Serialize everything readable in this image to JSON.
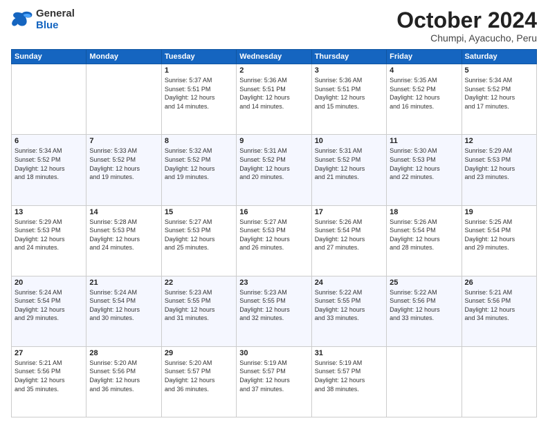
{
  "logo": {
    "line1": "General",
    "line2": "Blue"
  },
  "title": "October 2024",
  "subtitle": "Chumpi, Ayacucho, Peru",
  "days": [
    "Sunday",
    "Monday",
    "Tuesday",
    "Wednesday",
    "Thursday",
    "Friday",
    "Saturday"
  ],
  "weeks": [
    [
      {
        "date": "",
        "info": ""
      },
      {
        "date": "",
        "info": ""
      },
      {
        "date": "1",
        "info": "Sunrise: 5:37 AM\nSunset: 5:51 PM\nDaylight: 12 hours\nand 14 minutes."
      },
      {
        "date": "2",
        "info": "Sunrise: 5:36 AM\nSunset: 5:51 PM\nDaylight: 12 hours\nand 14 minutes."
      },
      {
        "date": "3",
        "info": "Sunrise: 5:36 AM\nSunset: 5:51 PM\nDaylight: 12 hours\nand 15 minutes."
      },
      {
        "date": "4",
        "info": "Sunrise: 5:35 AM\nSunset: 5:52 PM\nDaylight: 12 hours\nand 16 minutes."
      },
      {
        "date": "5",
        "info": "Sunrise: 5:34 AM\nSunset: 5:52 PM\nDaylight: 12 hours\nand 17 minutes."
      }
    ],
    [
      {
        "date": "6",
        "info": "Sunrise: 5:34 AM\nSunset: 5:52 PM\nDaylight: 12 hours\nand 18 minutes."
      },
      {
        "date": "7",
        "info": "Sunrise: 5:33 AM\nSunset: 5:52 PM\nDaylight: 12 hours\nand 19 minutes."
      },
      {
        "date": "8",
        "info": "Sunrise: 5:32 AM\nSunset: 5:52 PM\nDaylight: 12 hours\nand 19 minutes."
      },
      {
        "date": "9",
        "info": "Sunrise: 5:31 AM\nSunset: 5:52 PM\nDaylight: 12 hours\nand 20 minutes."
      },
      {
        "date": "10",
        "info": "Sunrise: 5:31 AM\nSunset: 5:52 PM\nDaylight: 12 hours\nand 21 minutes."
      },
      {
        "date": "11",
        "info": "Sunrise: 5:30 AM\nSunset: 5:53 PM\nDaylight: 12 hours\nand 22 minutes."
      },
      {
        "date": "12",
        "info": "Sunrise: 5:29 AM\nSunset: 5:53 PM\nDaylight: 12 hours\nand 23 minutes."
      }
    ],
    [
      {
        "date": "13",
        "info": "Sunrise: 5:29 AM\nSunset: 5:53 PM\nDaylight: 12 hours\nand 24 minutes."
      },
      {
        "date": "14",
        "info": "Sunrise: 5:28 AM\nSunset: 5:53 PM\nDaylight: 12 hours\nand 24 minutes."
      },
      {
        "date": "15",
        "info": "Sunrise: 5:27 AM\nSunset: 5:53 PM\nDaylight: 12 hours\nand 25 minutes."
      },
      {
        "date": "16",
        "info": "Sunrise: 5:27 AM\nSunset: 5:53 PM\nDaylight: 12 hours\nand 26 minutes."
      },
      {
        "date": "17",
        "info": "Sunrise: 5:26 AM\nSunset: 5:54 PM\nDaylight: 12 hours\nand 27 minutes."
      },
      {
        "date": "18",
        "info": "Sunrise: 5:26 AM\nSunset: 5:54 PM\nDaylight: 12 hours\nand 28 minutes."
      },
      {
        "date": "19",
        "info": "Sunrise: 5:25 AM\nSunset: 5:54 PM\nDaylight: 12 hours\nand 29 minutes."
      }
    ],
    [
      {
        "date": "20",
        "info": "Sunrise: 5:24 AM\nSunset: 5:54 PM\nDaylight: 12 hours\nand 29 minutes."
      },
      {
        "date": "21",
        "info": "Sunrise: 5:24 AM\nSunset: 5:54 PM\nDaylight: 12 hours\nand 30 minutes."
      },
      {
        "date": "22",
        "info": "Sunrise: 5:23 AM\nSunset: 5:55 PM\nDaylight: 12 hours\nand 31 minutes."
      },
      {
        "date": "23",
        "info": "Sunrise: 5:23 AM\nSunset: 5:55 PM\nDaylight: 12 hours\nand 32 minutes."
      },
      {
        "date": "24",
        "info": "Sunrise: 5:22 AM\nSunset: 5:55 PM\nDaylight: 12 hours\nand 33 minutes."
      },
      {
        "date": "25",
        "info": "Sunrise: 5:22 AM\nSunset: 5:56 PM\nDaylight: 12 hours\nand 33 minutes."
      },
      {
        "date": "26",
        "info": "Sunrise: 5:21 AM\nSunset: 5:56 PM\nDaylight: 12 hours\nand 34 minutes."
      }
    ],
    [
      {
        "date": "27",
        "info": "Sunrise: 5:21 AM\nSunset: 5:56 PM\nDaylight: 12 hours\nand 35 minutes."
      },
      {
        "date": "28",
        "info": "Sunrise: 5:20 AM\nSunset: 5:56 PM\nDaylight: 12 hours\nand 36 minutes."
      },
      {
        "date": "29",
        "info": "Sunrise: 5:20 AM\nSunset: 5:57 PM\nDaylight: 12 hours\nand 36 minutes."
      },
      {
        "date": "30",
        "info": "Sunrise: 5:19 AM\nSunset: 5:57 PM\nDaylight: 12 hours\nand 37 minutes."
      },
      {
        "date": "31",
        "info": "Sunrise: 5:19 AM\nSunset: 5:57 PM\nDaylight: 12 hours\nand 38 minutes."
      },
      {
        "date": "",
        "info": ""
      },
      {
        "date": "",
        "info": ""
      }
    ]
  ]
}
